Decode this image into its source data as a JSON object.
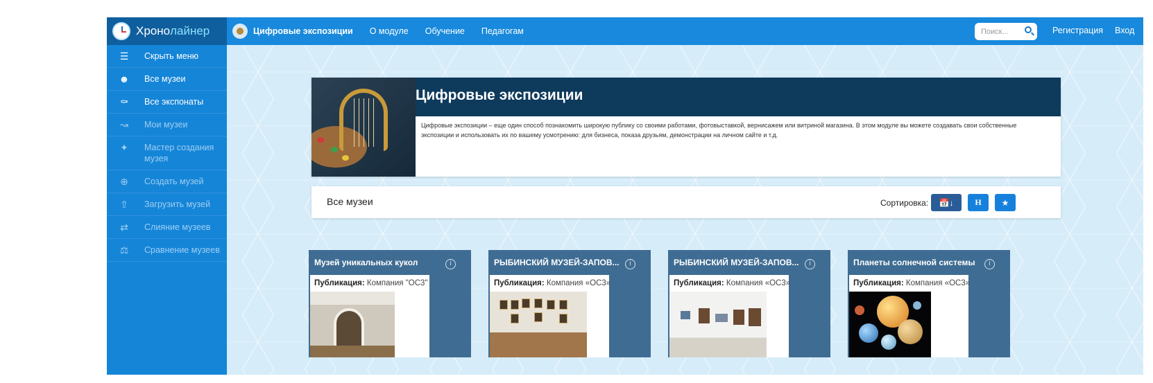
{
  "brand": {
    "part1": "Хроно",
    "part2": "лайнер"
  },
  "sidebar": {
    "items": [
      {
        "icon": "menu-icon",
        "label": "Скрыть меню",
        "active": true
      },
      {
        "icon": "users-icon",
        "label": "Все музеи",
        "active": true
      },
      {
        "icon": "vase-icon",
        "label": "Все экспонаты",
        "active": true
      },
      {
        "icon": "chart-icon",
        "label": "Мои музеи",
        "active": false
      },
      {
        "icon": "wand-icon",
        "label": "Мастер создания музея",
        "active": false
      },
      {
        "icon": "plus-circle-icon",
        "label": "Создать музей",
        "active": false
      },
      {
        "icon": "upload-icon",
        "label": "Загрузить музей",
        "active": false
      },
      {
        "icon": "merge-icon",
        "label": "Слияние музеев",
        "active": false
      },
      {
        "icon": "scales-icon",
        "label": "Сравнение музеев",
        "active": false
      }
    ]
  },
  "topbar": {
    "module": "Цифровые экспозиции",
    "nav": [
      "О модуле",
      "Обучение",
      "Педагогам"
    ],
    "search_placeholder": "Поиск...",
    "register": "Регистрация",
    "login": "Вход"
  },
  "hero": {
    "title": "Цифровые экспозиции",
    "description": "Цифровые экспозиции – еще один способ познакомить широкую публику со своими работами, фотовыставкой, вернисажем или витриной магазина. В этом модуле вы можете создавать свои собственные экспозиции и использовать их по вашему усмотрению: для бизнеса, показа друзьям, демонстрации на личном сайте и т.д."
  },
  "listing": {
    "title": "Все музеи",
    "sort_label": "Сортировка:",
    "sort_alpha": "Н"
  },
  "cards": [
    {
      "title": "Музей уникальных кукол",
      "pub_label": "Публикация:",
      "org": "Компания \"ОС3\""
    },
    {
      "title": "РЫБИНСКИЙ МУЗЕЙ-ЗАПОВ...",
      "pub_label": "Публикация:",
      "org": "Компания «ОС3»"
    },
    {
      "title": "РЫБИНСКИЙ МУЗЕЙ-ЗАПОВ...",
      "pub_label": "Публикация:",
      "org": "Компания «ОС3»"
    },
    {
      "title": "Планеты солнечной системы",
      "pub_label": "Публикация:",
      "org": "Компания «ОС3»"
    }
  ],
  "colors": {
    "sidebar": "#1585d8",
    "topbar": "#1889dc",
    "hero_header": "#0e3a5c",
    "card": "#3f6c92",
    "sort_active": "#2a5d97"
  }
}
